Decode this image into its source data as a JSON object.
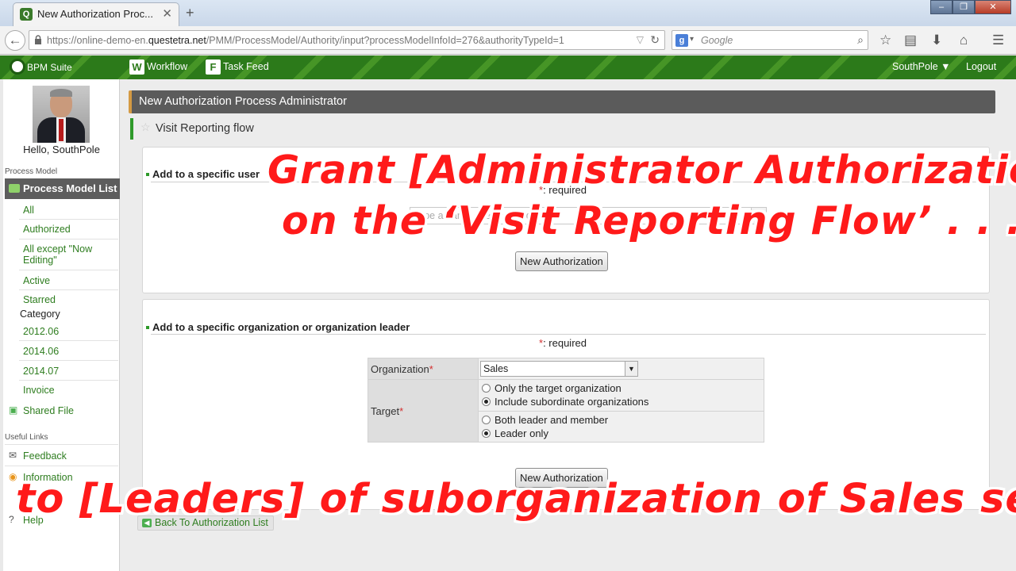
{
  "browser": {
    "tab_title": "New Authorization Proc...",
    "url_prefix": "https://online-demo-en.",
    "url_host": "questetra.net",
    "url_path": "/PMM/ProcessModel/Authority/input?processModelInfoId=276&authorityTypeId=1",
    "search_placeholder": "Google"
  },
  "app": {
    "name": "BPM Suite",
    "nav": [
      "Workflow",
      "Task Feed"
    ],
    "user_menu": "SouthPole ▼",
    "logout": "Logout"
  },
  "sidebar": {
    "greeting": "Hello, SouthPole",
    "section_process_model": "Process Model",
    "process_model_list": "Process Model List",
    "filters": [
      "All",
      "Authorized",
      "All except \"Now Editing\"",
      "Active",
      "Starred"
    ],
    "category_label": "Category",
    "categories": [
      "2012.06",
      "2014.06",
      "2014.07",
      "Invoice"
    ],
    "shared_file": "Shared File",
    "section_useful_links": "Useful Links",
    "feedback": "Feedback",
    "information": "Information",
    "help": "Help"
  },
  "main": {
    "page_title": "New Authorization Process Administrator",
    "flow_title": "Visit Reporting flow",
    "user_section": {
      "heading": "Add to a specific user",
      "required_mark": "*",
      "required_text": ": required",
      "search_placeholder": "Type a name or e-mail address",
      "button": "New Authorization"
    },
    "org_section": {
      "heading": "Add to a specific organization or organization leader",
      "required_mark": "*",
      "required_text": ": required",
      "organization_label": "Organization",
      "organization_value": "Sales",
      "target_label": "Target",
      "target_options": [
        "Only the target organization",
        "Include subordinate organizations"
      ],
      "target_selected": 1,
      "member_options": [
        "Both leader and member",
        "Leader only"
      ],
      "member_selected": 1,
      "button": "New Authorization"
    },
    "back_link": "Back To Authorization List"
  },
  "captions": {
    "line1": "Grant [Administrator Authorization]",
    "line2": "on the ‘Visit Reporting Flow’ . . .",
    "line3": "to [Leaders] of suborganization of Sales section"
  },
  "colors": {
    "brand_green": "#2c7a1a",
    "caption_red": "#ff1a1a",
    "required_red": "#d32f2f"
  }
}
